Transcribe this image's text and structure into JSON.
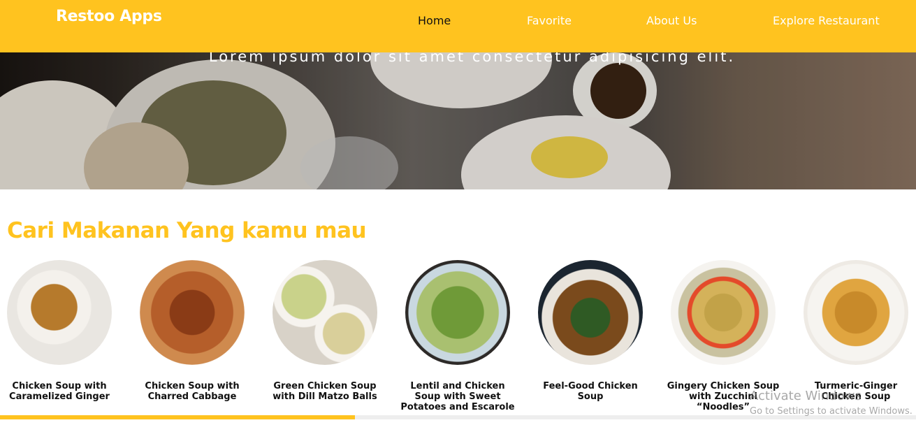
{
  "navbar": {
    "brand": "Restoo Apps",
    "items": [
      {
        "label": "Home",
        "active": true
      },
      {
        "label": "Favorite",
        "active": false
      },
      {
        "label": "About Us",
        "active": false
      },
      {
        "label": "Explore Restaurant",
        "active": false
      }
    ]
  },
  "hero": {
    "tagline": "Lorem ipsum dolor sit amet consectetur adipisicing elit."
  },
  "section": {
    "title": "Cari Makanan Yang kamu mau"
  },
  "foods": [
    {
      "name": "Chicken Soup with Caramelized Ginger",
      "icon": "chicken-soup-image"
    },
    {
      "name": "Chicken Soup with Charred Cabbage",
      "icon": "chicken-soup-image"
    },
    {
      "name": "Green Chicken Soup with Dill Matzo Balls",
      "icon": "chicken-soup-image"
    },
    {
      "name": "Lentil and Chicken Soup with Sweet Potatoes and Escarole",
      "icon": "chicken-soup-image"
    },
    {
      "name": "Feel-Good Chicken Soup",
      "icon": "chicken-soup-image"
    },
    {
      "name": "Gingery Chicken Soup with Zucchini “Noodles”",
      "icon": "chicken-soup-image"
    },
    {
      "name": "Turmeric-Ginger Chicken Soup",
      "icon": "chicken-soup-image"
    }
  ],
  "scroll": {
    "progress": 0.39
  },
  "watermark": {
    "title": "Activate Windows",
    "subtitle": "Go to Settings to activate Windows."
  },
  "colors": {
    "accent": "#ffc31f",
    "text": "#111111"
  }
}
